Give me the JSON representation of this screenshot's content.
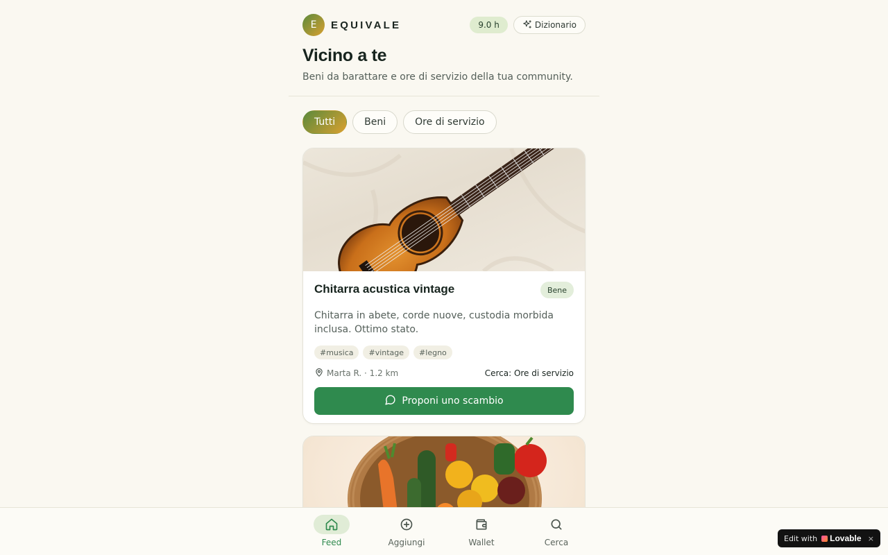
{
  "header": {
    "logo_letter": "E",
    "brand": "EQUIVALE",
    "hours_balance": "9.0 h",
    "dictionary_label": "Dizionario"
  },
  "page": {
    "title": "Vicino a te",
    "subtitle": "Beni da barattare e ore di servizio della tua community."
  },
  "filters": [
    {
      "label": "Tutti",
      "active": true
    },
    {
      "label": "Beni",
      "active": false
    },
    {
      "label": "Ore di servizio",
      "active": false
    }
  ],
  "listings": [
    {
      "title": "Chitarra acustica vintage",
      "type": "Bene",
      "description": "Chitarra in abete, corde nuove, custodia morbida inclusa. Ottimo stato.",
      "tags": [
        "#musica",
        "#vintage",
        "#legno"
      ],
      "owner_distance": "Marta R. · 1.2 km",
      "seeking": "Cerca: Ore di servizio",
      "cta": "Proponi uno scambio",
      "image": "acoustic-guitar-photo"
    },
    {
      "image": "vegetable-basket-photo"
    }
  ],
  "bottom_nav": [
    {
      "label": "Feed",
      "icon": "home-icon",
      "active": true
    },
    {
      "label": "Aggiungi",
      "icon": "plus-circle-icon",
      "active": false
    },
    {
      "label": "Wallet",
      "icon": "wallet-icon",
      "active": false
    },
    {
      "label": "Cerca",
      "icon": "search-icon",
      "active": false
    }
  ],
  "edit_badge": {
    "prefix": "Edit with",
    "brand": "Lovable",
    "close": "×"
  }
}
